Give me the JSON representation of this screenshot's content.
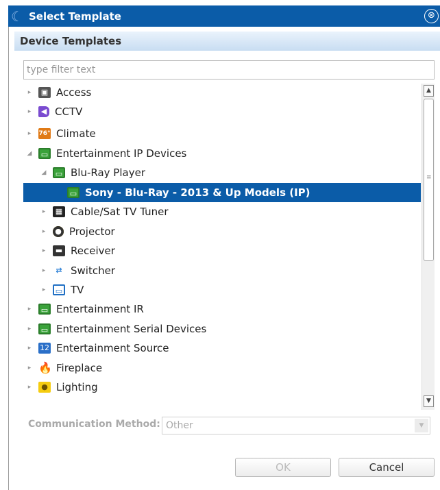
{
  "window": {
    "title": "Select Template",
    "close_glyph": "⊗"
  },
  "section": {
    "title": "Device Templates"
  },
  "filter": {
    "placeholder": "type filter text",
    "value": ""
  },
  "tree": [
    {
      "label": "Access",
      "icon": "lock-icon",
      "glyph": "▣",
      "expanded": false,
      "level": 0,
      "selected": false
    },
    {
      "label": "CCTV",
      "icon": "camera-icon",
      "glyph": "◀",
      "expanded": false,
      "level": 0,
      "selected": false
    },
    {
      "label": "Climate",
      "icon": "thermostat-icon",
      "glyph": "76°",
      "expanded": false,
      "level": 0,
      "selected": false
    },
    {
      "label": "Entertainment IP Devices",
      "icon": "entertainment-icon",
      "glyph": "▭",
      "expanded": true,
      "level": 0,
      "selected": false
    },
    {
      "label": "Blu-Ray Player",
      "icon": "entertainment-icon",
      "glyph": "▭",
      "expanded": true,
      "level": 1,
      "selected": false
    },
    {
      "label": "Sony - Blu-Ray - 2013 & Up Models (IP)",
      "icon": "entertainment-icon",
      "glyph": "▭",
      "expanded": null,
      "level": 2,
      "selected": true
    },
    {
      "label": "Cable/Sat TV Tuner",
      "icon": "tuner-icon",
      "glyph": "▦",
      "expanded": false,
      "level": 1,
      "selected": false
    },
    {
      "label": "Projector",
      "icon": "projector-icon",
      "glyph": "●",
      "expanded": false,
      "level": 1,
      "selected": false
    },
    {
      "label": "Receiver",
      "icon": "receiver-icon",
      "glyph": "▬",
      "expanded": false,
      "level": 1,
      "selected": false
    },
    {
      "label": "Switcher",
      "icon": "switcher-icon",
      "glyph": "⇄",
      "expanded": false,
      "level": 1,
      "selected": false
    },
    {
      "label": "TV",
      "icon": "tv-icon",
      "glyph": "▭",
      "expanded": false,
      "level": 1,
      "selected": false
    },
    {
      "label": "Entertainment IR",
      "icon": "entertainment-icon",
      "glyph": "▭",
      "expanded": false,
      "level": 0,
      "selected": false
    },
    {
      "label": "Entertainment Serial Devices",
      "icon": "entertainment-icon",
      "glyph": "▭",
      "expanded": false,
      "level": 0,
      "selected": false
    },
    {
      "label": "Entertainment Source",
      "icon": "source-icon",
      "glyph": "12",
      "expanded": false,
      "level": 0,
      "selected": false
    },
    {
      "label": "Fireplace",
      "icon": "fire-icon",
      "glyph": "🔥",
      "expanded": false,
      "level": 0,
      "selected": false
    },
    {
      "label": "Lighting",
      "icon": "light-icon",
      "glyph": "●",
      "expanded": false,
      "level": 0,
      "selected": false
    }
  ],
  "communication": {
    "label": "Communication Method:",
    "value": "Other"
  },
  "buttons": {
    "ok": "OK",
    "cancel": "Cancel"
  },
  "colors": {
    "titlebar": "#0b5ca8",
    "selection": "#0b5ca8"
  }
}
